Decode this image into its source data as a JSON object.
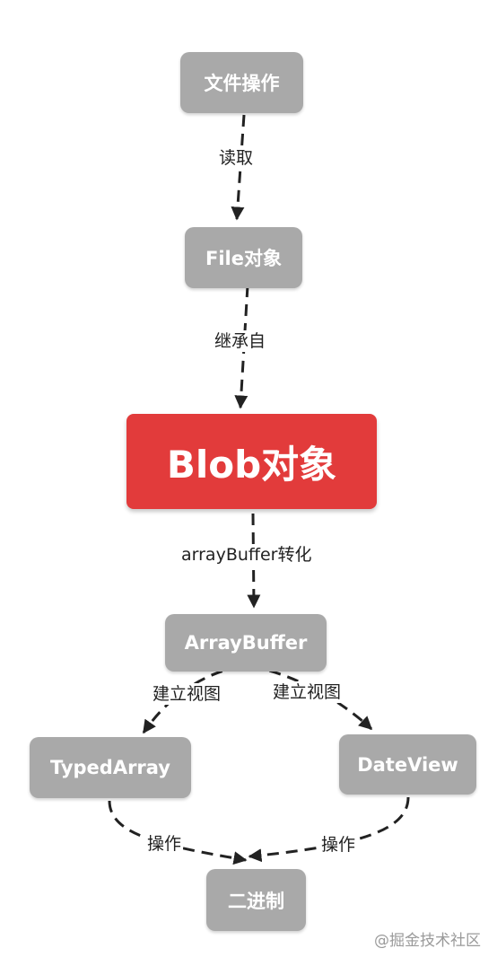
{
  "nodes": {
    "file_ops": "文件操作",
    "file_obj": "File对象",
    "blob": "Blob对象",
    "array_buffer": "ArrayBuffer",
    "typed_array": "TypedArray",
    "date_view": "DateView",
    "binary": "二进制"
  },
  "edges": {
    "read": "读取",
    "inherit": "继承自",
    "convert": "arrayBuffer转化",
    "view_left": "建立视图",
    "view_right": "建立视图",
    "op_left": "操作",
    "op_right": "操作"
  },
  "colors": {
    "node": "#a9a9a9",
    "main_node": "#e23b3b",
    "edge": "#222222"
  },
  "watermark": "@掘金技术社区"
}
